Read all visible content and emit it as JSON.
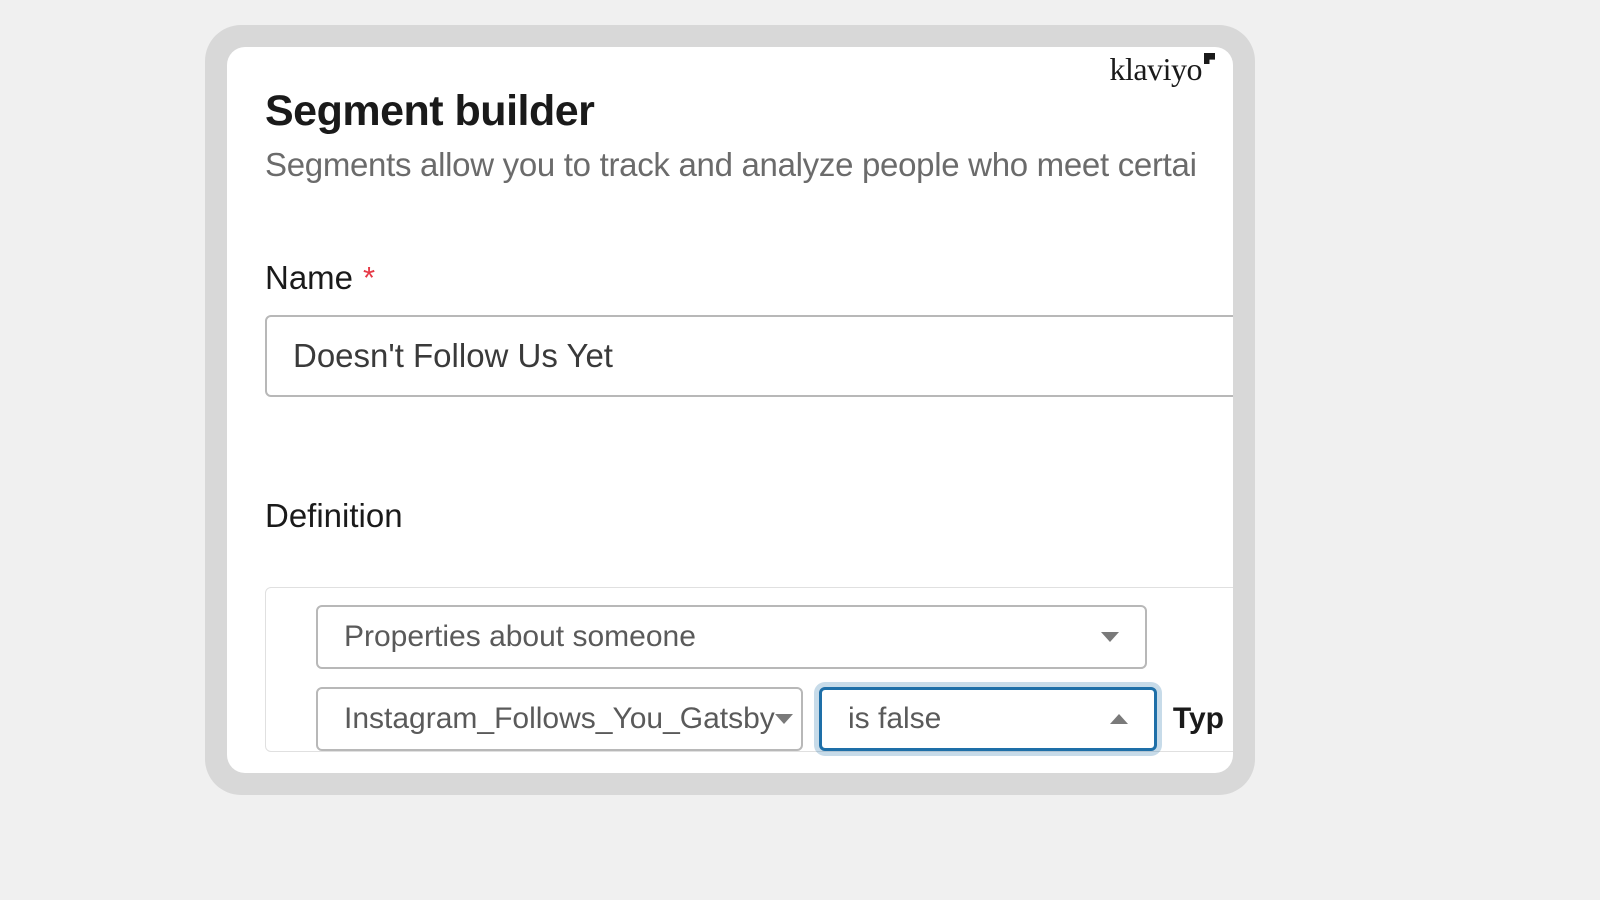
{
  "brand": {
    "logo_text": "klaviyo"
  },
  "page": {
    "title": "Segment builder",
    "subtitle": "Segments allow you to track and analyze people who meet certai"
  },
  "form": {
    "name_label": "Name",
    "required_marker": "*",
    "name_value": "Doesn't Follow Us Yet",
    "definition_heading": "Definition",
    "condition_type": "Properties about someone",
    "property": "Instagram_Follows_You_Gatsby",
    "operator": "is false",
    "type_label_partial": "Typ"
  }
}
